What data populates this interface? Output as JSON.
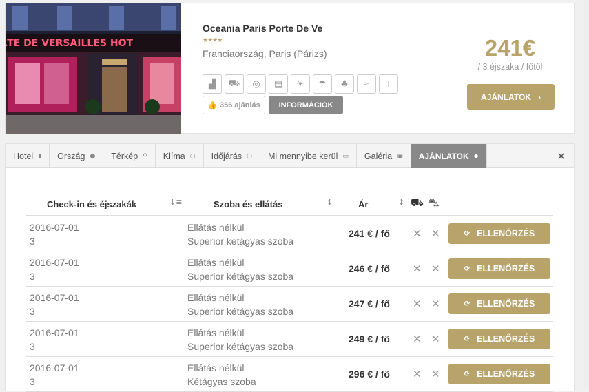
{
  "hotel": {
    "name": "Oceania Paris Porte De Ve",
    "stars": "★★★★",
    "location": "Franciaország, Paris (Párizs)",
    "photo_sign": "RTE DE VERSAILLES HOT",
    "likes": "356 ajánlás",
    "info_button": "INFORMÁCIÓK",
    "price": "241€",
    "price_sub": "/ 3 éjszaka / főtől",
    "offers_button": "AJÁNLATOK",
    "amenities": [
      "factory-icon",
      "bus-icon",
      "clock-icon",
      "hotel-icon",
      "beach-icon",
      "umbrella-icon",
      "palm-icon",
      "pool-icon",
      "tower-icon"
    ]
  },
  "tabs": [
    {
      "label": "Hotel",
      "icon": "bookmark-icon"
    },
    {
      "label": "Ország",
      "icon": "globe-icon"
    },
    {
      "label": "Térkép",
      "icon": "pin-icon"
    },
    {
      "label": "Klíma",
      "icon": "circle-icon"
    },
    {
      "label": "Időjárás",
      "icon": "circle-icon"
    },
    {
      "label": "Mi mennyibe kerül",
      "icon": "money-icon"
    },
    {
      "label": "Galéria",
      "icon": "image-icon"
    },
    {
      "label": "AJÁNLATOK",
      "icon": "tag-icon"
    }
  ],
  "table": {
    "headers": {
      "checkin": "Check-in és éjszakák",
      "room": "Szoba és ellátás",
      "price": "Ár"
    },
    "check_button": "ELLENŐRZÉS",
    "rows": [
      {
        "date": "2016-07-01",
        "nights": "3",
        "board": "Ellátás nélkül",
        "room": "Superior kétágyas szoba",
        "price": "241 € / fő"
      },
      {
        "date": "2016-07-01",
        "nights": "3",
        "board": "Ellátás nélkül",
        "room": "Superior kétágyas szoba",
        "price": "246 € / fő"
      },
      {
        "date": "2016-07-01",
        "nights": "3",
        "board": "Ellátás nélkül",
        "room": "Superior kétágyas szoba",
        "price": "247 € / fő"
      },
      {
        "date": "2016-07-01",
        "nights": "3",
        "board": "Ellátás nélkül",
        "room": "Superior kétágyas szoba",
        "price": "249 € / fő"
      },
      {
        "date": "2016-07-01",
        "nights": "3",
        "board": "Ellátás nélkül",
        "room": "Kétágyas szoba",
        "price": "296 € / fő"
      }
    ]
  },
  "colors": {
    "gold": "#b8a46b",
    "grey_button": "#888888"
  }
}
